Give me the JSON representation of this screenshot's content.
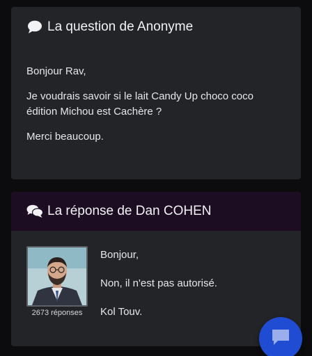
{
  "question": {
    "title": "La question de Anonyme",
    "icon": "comment-icon",
    "paragraphs": [
      "Bonjour Rav,",
      "Je voudrais savoir si le lait Candy Up choco coco édition Michou est Cachère ?",
      "Merci beaucoup."
    ]
  },
  "answer": {
    "title": "La réponse de Dan COHEN",
    "icon": "comments-icon",
    "author_count": "2673 réponses",
    "paragraphs": [
      "Bonjour,",
      "Non, il n'est pas autorisé.",
      "Kol Touv."
    ]
  },
  "fab": {
    "icon": "chat-icon"
  },
  "colors": {
    "background": "#0c0c0e",
    "card": "#232427",
    "answer_header": "#1c0d22",
    "fab": "#1f4cd3"
  }
}
